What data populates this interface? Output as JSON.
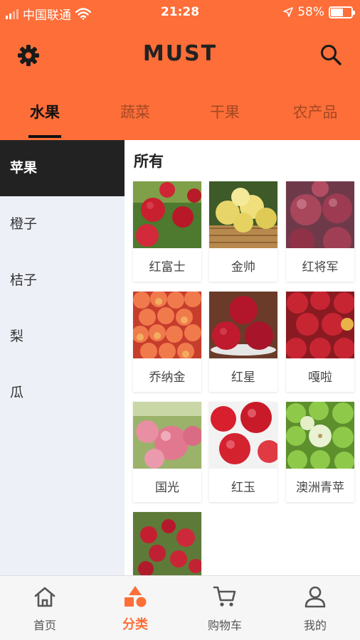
{
  "status_bar": {
    "carrier": "中国联通",
    "time": "21:28",
    "battery": "58%"
  },
  "header": {
    "title": "MUST",
    "icons": [
      "gear-icon",
      "search-icon"
    ]
  },
  "tabs": [
    {
      "label": "水果",
      "active": true
    },
    {
      "label": "蔬菜",
      "active": false
    },
    {
      "label": "干果",
      "active": false
    },
    {
      "label": "农产品",
      "active": false
    }
  ],
  "sidebar": {
    "items": [
      {
        "label": "苹果",
        "active": true
      },
      {
        "label": "橙子",
        "active": false
      },
      {
        "label": "桔子",
        "active": false
      },
      {
        "label": "梨",
        "active": false
      },
      {
        "label": "瓜",
        "active": false
      }
    ]
  },
  "content": {
    "heading": "所有",
    "products": [
      {
        "name": "红富士"
      },
      {
        "name": "金帅"
      },
      {
        "name": "红将军"
      },
      {
        "name": "乔纳金"
      },
      {
        "name": "红星"
      },
      {
        "name": "嘎啦"
      },
      {
        "name": "国光"
      },
      {
        "name": "红玉"
      },
      {
        "name": "澳洲青苹"
      },
      {
        "name": ""
      }
    ]
  },
  "tabbar": {
    "items": [
      {
        "label": "首页",
        "icon": "home-icon",
        "active": false
      },
      {
        "label": "分类",
        "icon": "category-icon",
        "active": true
      },
      {
        "label": "购物车",
        "icon": "cart-icon",
        "active": false
      },
      {
        "label": "我的",
        "icon": "profile-icon",
        "active": false
      }
    ]
  },
  "colors": {
    "accent": "#fe6e38",
    "sidebar_bg": "#eef0f8",
    "sidebar_active": "#222222"
  }
}
